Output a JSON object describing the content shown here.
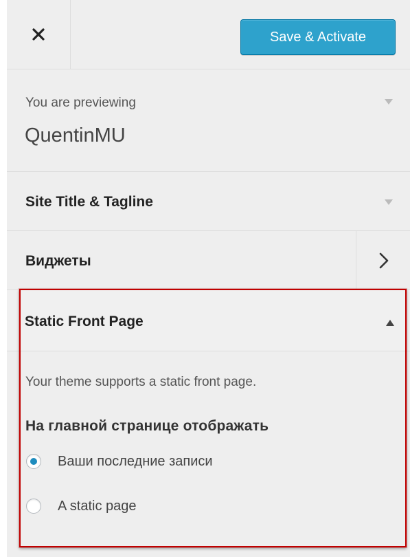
{
  "header": {
    "close_icon": "close-icon",
    "save_label": "Save & Activate"
  },
  "preview": {
    "label": "You are previewing",
    "theme_name": "QuentinMU"
  },
  "sections": {
    "site_title": "Site Title & Tagline",
    "widgets": "Виджеты",
    "static_front_page": "Static Front Page"
  },
  "static_front_page": {
    "description": "Your theme supports a static front page.",
    "show_label": "На главной странице отображать",
    "options": [
      {
        "label": "Ваши последние записи",
        "checked": true
      },
      {
        "label": "A static page",
        "checked": false
      }
    ]
  },
  "colors": {
    "accent": "#2ea2cc",
    "radio_checked": "#1e8cbe",
    "highlight": "#c00000",
    "panel_bg": "#eeeeee"
  }
}
